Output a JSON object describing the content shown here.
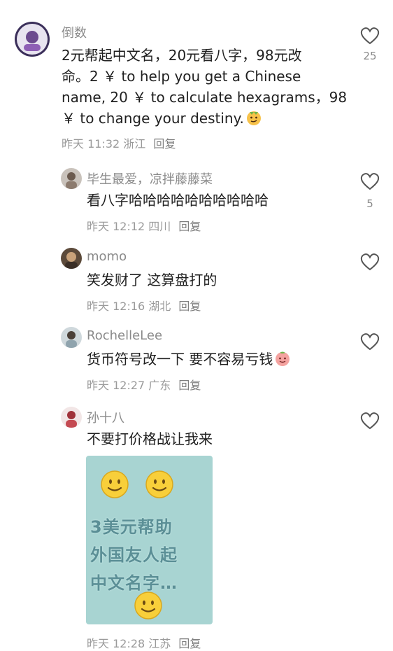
{
  "comments": [
    {
      "username": "倒数",
      "lines": [
        "2元帮起中文名，20元看八字，98元改",
        "命。2 ￥ to help you get a Chinese",
        "name, 20 ￥ to calculate hexagrams，98",
        "￥ to change your destiny."
      ],
      "time": "昨天 11:32",
      "location": "浙江",
      "reply": "回复",
      "likes": "25"
    },
    {
      "username": "毕生最爱，凉拌藤藤菜",
      "lines": [
        "看八字哈哈哈哈哈哈哈哈哈哈"
      ],
      "time": "昨天 12:12",
      "location": "四川",
      "reply": "回复",
      "likes": "5"
    },
    {
      "username": "momo",
      "lines": [
        "笑发财了 这算盘打的"
      ],
      "time": "昨天 12:16",
      "location": "湖北",
      "reply": "回复",
      "likes": ""
    },
    {
      "username": "RochelleLee",
      "lines": [
        "货币符号改一下 要不容易亏钱"
      ],
      "time": "昨天 12:27",
      "location": "广东",
      "reply": "回复",
      "likes": ""
    },
    {
      "username": "孙十八",
      "lines": [
        "不要打价格战让我来"
      ],
      "time": "昨天 12:28",
      "location": "江苏",
      "reply": "回复",
      "likes": ""
    }
  ],
  "attached_image": {
    "lines": [
      "3美元帮助",
      "外国友人起",
      "中文名字…"
    ]
  },
  "icons": {
    "like": "heart-outline-icon",
    "emoji_1": "smirk-face-emoji",
    "emoji_2": "peach-face-emoji",
    "smile": "smiling-face-emoji"
  },
  "colors": {
    "username": "#8a8a8a",
    "meta": "#9a9a9a",
    "text": "#1f1f1f",
    "photo_bg": "#a8d4d2"
  }
}
